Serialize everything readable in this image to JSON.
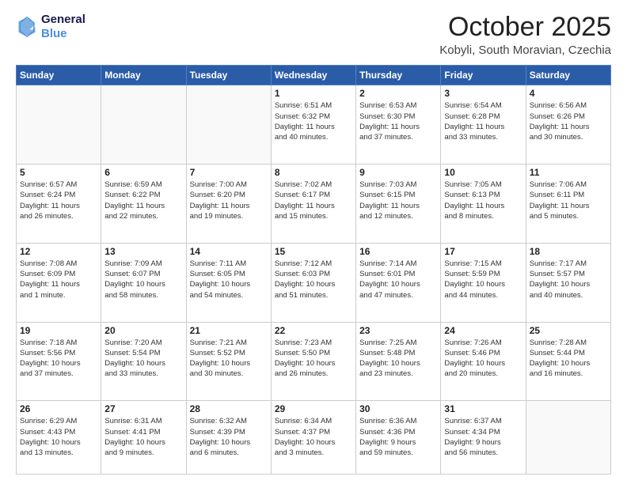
{
  "header": {
    "logo_line1": "General",
    "logo_line2": "Blue",
    "month_title": "October 2025",
    "location": "Kobyli, South Moravian, Czechia"
  },
  "weekdays": [
    "Sunday",
    "Monday",
    "Tuesday",
    "Wednesday",
    "Thursday",
    "Friday",
    "Saturday"
  ],
  "weeks": [
    [
      {
        "day": "",
        "info": ""
      },
      {
        "day": "",
        "info": ""
      },
      {
        "day": "",
        "info": ""
      },
      {
        "day": "1",
        "info": "Sunrise: 6:51 AM\nSunset: 6:32 PM\nDaylight: 11 hours\nand 40 minutes."
      },
      {
        "day": "2",
        "info": "Sunrise: 6:53 AM\nSunset: 6:30 PM\nDaylight: 11 hours\nand 37 minutes."
      },
      {
        "day": "3",
        "info": "Sunrise: 6:54 AM\nSunset: 6:28 PM\nDaylight: 11 hours\nand 33 minutes."
      },
      {
        "day": "4",
        "info": "Sunrise: 6:56 AM\nSunset: 6:26 PM\nDaylight: 11 hours\nand 30 minutes."
      }
    ],
    [
      {
        "day": "5",
        "info": "Sunrise: 6:57 AM\nSunset: 6:24 PM\nDaylight: 11 hours\nand 26 minutes."
      },
      {
        "day": "6",
        "info": "Sunrise: 6:59 AM\nSunset: 6:22 PM\nDaylight: 11 hours\nand 22 minutes."
      },
      {
        "day": "7",
        "info": "Sunrise: 7:00 AM\nSunset: 6:20 PM\nDaylight: 11 hours\nand 19 minutes."
      },
      {
        "day": "8",
        "info": "Sunrise: 7:02 AM\nSunset: 6:17 PM\nDaylight: 11 hours\nand 15 minutes."
      },
      {
        "day": "9",
        "info": "Sunrise: 7:03 AM\nSunset: 6:15 PM\nDaylight: 11 hours\nand 12 minutes."
      },
      {
        "day": "10",
        "info": "Sunrise: 7:05 AM\nSunset: 6:13 PM\nDaylight: 11 hours\nand 8 minutes."
      },
      {
        "day": "11",
        "info": "Sunrise: 7:06 AM\nSunset: 6:11 PM\nDaylight: 11 hours\nand 5 minutes."
      }
    ],
    [
      {
        "day": "12",
        "info": "Sunrise: 7:08 AM\nSunset: 6:09 PM\nDaylight: 11 hours\nand 1 minute."
      },
      {
        "day": "13",
        "info": "Sunrise: 7:09 AM\nSunset: 6:07 PM\nDaylight: 10 hours\nand 58 minutes."
      },
      {
        "day": "14",
        "info": "Sunrise: 7:11 AM\nSunset: 6:05 PM\nDaylight: 10 hours\nand 54 minutes."
      },
      {
        "day": "15",
        "info": "Sunrise: 7:12 AM\nSunset: 6:03 PM\nDaylight: 10 hours\nand 51 minutes."
      },
      {
        "day": "16",
        "info": "Sunrise: 7:14 AM\nSunset: 6:01 PM\nDaylight: 10 hours\nand 47 minutes."
      },
      {
        "day": "17",
        "info": "Sunrise: 7:15 AM\nSunset: 5:59 PM\nDaylight: 10 hours\nand 44 minutes."
      },
      {
        "day": "18",
        "info": "Sunrise: 7:17 AM\nSunset: 5:57 PM\nDaylight: 10 hours\nand 40 minutes."
      }
    ],
    [
      {
        "day": "19",
        "info": "Sunrise: 7:18 AM\nSunset: 5:56 PM\nDaylight: 10 hours\nand 37 minutes."
      },
      {
        "day": "20",
        "info": "Sunrise: 7:20 AM\nSunset: 5:54 PM\nDaylight: 10 hours\nand 33 minutes."
      },
      {
        "day": "21",
        "info": "Sunrise: 7:21 AM\nSunset: 5:52 PM\nDaylight: 10 hours\nand 30 minutes."
      },
      {
        "day": "22",
        "info": "Sunrise: 7:23 AM\nSunset: 5:50 PM\nDaylight: 10 hours\nand 26 minutes."
      },
      {
        "day": "23",
        "info": "Sunrise: 7:25 AM\nSunset: 5:48 PM\nDaylight: 10 hours\nand 23 minutes."
      },
      {
        "day": "24",
        "info": "Sunrise: 7:26 AM\nSunset: 5:46 PM\nDaylight: 10 hours\nand 20 minutes."
      },
      {
        "day": "25",
        "info": "Sunrise: 7:28 AM\nSunset: 5:44 PM\nDaylight: 10 hours\nand 16 minutes."
      }
    ],
    [
      {
        "day": "26",
        "info": "Sunrise: 6:29 AM\nSunset: 4:43 PM\nDaylight: 10 hours\nand 13 minutes."
      },
      {
        "day": "27",
        "info": "Sunrise: 6:31 AM\nSunset: 4:41 PM\nDaylight: 10 hours\nand 9 minutes."
      },
      {
        "day": "28",
        "info": "Sunrise: 6:32 AM\nSunset: 4:39 PM\nDaylight: 10 hours\nand 6 minutes."
      },
      {
        "day": "29",
        "info": "Sunrise: 6:34 AM\nSunset: 4:37 PM\nDaylight: 10 hours\nand 3 minutes."
      },
      {
        "day": "30",
        "info": "Sunrise: 6:36 AM\nSunset: 4:36 PM\nDaylight: 9 hours\nand 59 minutes."
      },
      {
        "day": "31",
        "info": "Sunrise: 6:37 AM\nSunset: 4:34 PM\nDaylight: 9 hours\nand 56 minutes."
      },
      {
        "day": "",
        "info": ""
      }
    ]
  ]
}
